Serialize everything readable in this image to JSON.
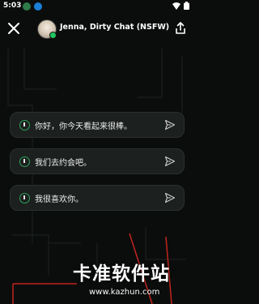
{
  "status_bar": {
    "time": "5:03",
    "icons": [
      "status-app-icon",
      "download-icon",
      "wifi-icon",
      "battery-icon"
    ]
  },
  "header": {
    "chat_title": "Jenna, Dirty Chat (NSFW)",
    "online": true
  },
  "suggestions": [
    {
      "text": "你好，你今天看起来很棒。"
    },
    {
      "text": "我们去约会吧。"
    },
    {
      "text": "我很喜欢你。"
    }
  ],
  "watermark": {
    "text": "卡准软件站",
    "url": "www.kazhun.com"
  },
  "colors": {
    "background": "#0b0d0c",
    "chip": "#1c201e",
    "accent_green": "#2ea05a",
    "circuit_red": "#c0241e"
  }
}
